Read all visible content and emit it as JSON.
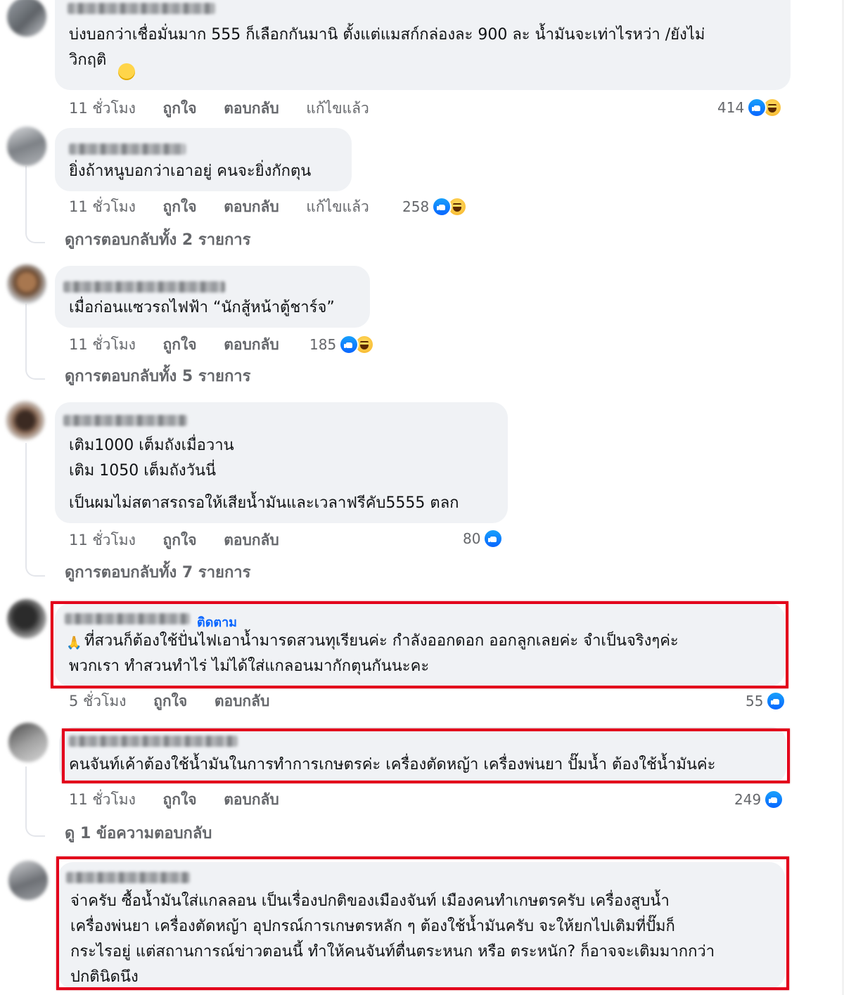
{
  "colors": {
    "bubble": "#f0f2f5",
    "meta": "#65676b",
    "like": "#0866ff",
    "highlight_border": "#e3001b"
  },
  "actions": {
    "like": "ถูกใจ",
    "reply": "ตอบกลับ",
    "edited": "แก้ไขแล้ว"
  },
  "comments": [
    {
      "text": "บ่งบอกว่าเชื่อมั่นมาก 555 ก็เลือกกันมานิ ตั้งแต่แมสก์กล่องละ 900 ละ น้ำมันจะเท่าไรหว่า /ยังไม่\nวิกฤติ",
      "time": "11 ชั่วโมง",
      "reaction_count": "414",
      "reactions": [
        "like-icon",
        "haha-icon"
      ],
      "edited": true
    },
    {
      "text": "ยิ่งถ้าหนูบอกว่าเอาอยู่ คนจะยิ่งกักตุน",
      "time": "11 ชั่วโมง",
      "reaction_count": "258",
      "reactions": [
        "like-icon",
        "haha-icon"
      ],
      "edited": true,
      "view_replies": "ดูการตอบกลับทั้ง 2 รายการ"
    },
    {
      "text": "เมื่อก่อนแซวรถไฟฟ้า “นักสู้หน้าตู้ชาร์จ”",
      "time": "11 ชั่วโมง",
      "reaction_count": "185",
      "reactions": [
        "like-icon",
        "haha-icon"
      ],
      "view_replies": "ดูการตอบกลับทั้ง 5 รายการ"
    },
    {
      "line1": "เติม1000 เต็มถังเมื่อวาน",
      "line2": "เติม 1050 เต็มถังวันนี่",
      "line3": "เป็นผมไม่สตาสรถรอให้เสียน้ำมันและเวลาฟรีคับ5555 ตลก",
      "time": "11 ชั่วโมง",
      "reaction_count": "80",
      "reactions": [
        "like-icon"
      ],
      "view_replies": "ดูการตอบกลับทั้ง 7 รายการ"
    },
    {
      "follow": "ติดตาม",
      "text": "ที่สวนก็ต้องใช้ปั่นไฟเอาน้ำมารดสวนทุเรียนค่ะ กำลังออกดอก ออกลูกเลยค่ะ จำเป็นจริงๆค่ะ\nพวกเรา ทำสวนทำไร่ ไม่ได้ใส่แกลอนมากักตุนกันนะคะ",
      "emoji": "🙏",
      "time": "5 ชั่วโมง",
      "reaction_count": "55",
      "reactions": [
        "like-icon"
      ],
      "highlighted": true
    },
    {
      "text": "คนจันท์เค้าต้องใช้น้ำมันในการทำการเกษตรค่ะ เครื่องตัดหญ้า เครื่องพ่นยา ปั๊มน้ำ ต้องใช้น้ำมันค่ะ",
      "time": "11 ชั่วโมง",
      "reaction_count": "249",
      "reactions": [
        "like-icon"
      ],
      "highlighted": true,
      "view_replies": "ดู 1 ข้อความตอบกลับ"
    },
    {
      "text": "จ่าครับ ซื้อน้ำมันใส่แกลลอน เป็นเรื่องปกติของเมืองจันท์ เมืองคนทำเกษตรครับ เครื่องสูบน้ำ\nเครื่องพ่นยา เครื่องตัดหญ้า อุปกรณ์การเกษตรหลัก ๆ ต้องใช้น้ำมันครับ จะให้ยกไปเติมที่ปั๊มก็\nกระไรอยู่ แต่สถานการณ์ข่าวตอนนี้ ทำให้คนจันท์ตื่นตระหนก หรือ ตระหนัก? ก็อาจจะเติมมากกว่า\nปกตินิดนึง",
      "highlighted": true
    }
  ]
}
